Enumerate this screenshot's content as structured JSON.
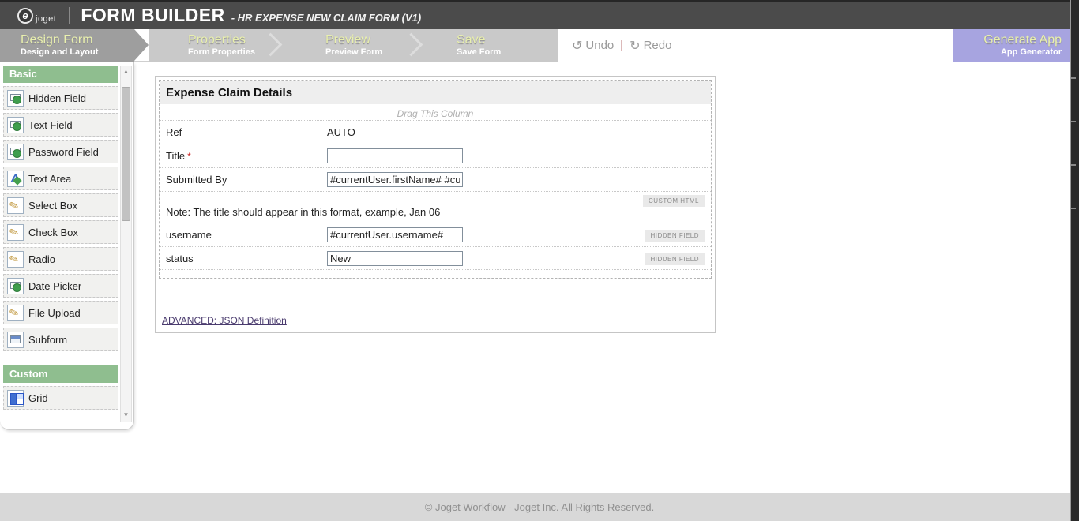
{
  "header": {
    "logo_glyph": "e",
    "logo_text": "joget",
    "app_title": "FORM BUILDER",
    "form_subtitle": "- HR EXPENSE NEW CLAIM FORM (V1)"
  },
  "tabs": [
    {
      "title": "Design Form",
      "subtitle": "Design and Layout",
      "active": true
    },
    {
      "title": "Properties",
      "subtitle": "Form Properties",
      "active": false
    },
    {
      "title": "Preview",
      "subtitle": "Preview Form",
      "active": false
    },
    {
      "title": "Save",
      "subtitle": "Save Form",
      "active": false
    }
  ],
  "toolbar": {
    "undo_icon": "↺",
    "undo_label": "Undo",
    "separator": "|",
    "redo_icon": "↻",
    "redo_label": "Redo"
  },
  "generate_tab": {
    "title": "Generate App",
    "subtitle": "App Generator"
  },
  "palette": {
    "sections": [
      {
        "title": "Basic",
        "items": [
          {
            "label": "Hidden Field",
            "icon": "textfield-icon"
          },
          {
            "label": "Text Field",
            "icon": "textfield-icon"
          },
          {
            "label": "Password Field",
            "icon": "textfield-icon"
          },
          {
            "label": "Text Area",
            "icon": "textarea-icon"
          },
          {
            "label": "Select Box",
            "icon": "pencil-box-icon"
          },
          {
            "label": "Check Box",
            "icon": "pencil-box-icon"
          },
          {
            "label": "Radio",
            "icon": "pencil-box-icon"
          },
          {
            "label": "Date Picker",
            "icon": "textfield-icon"
          },
          {
            "label": "File Upload",
            "icon": "pencil-box-icon"
          },
          {
            "label": "Subform",
            "icon": "subform-icon"
          }
        ]
      },
      {
        "title": "Custom",
        "items": [
          {
            "label": "Grid",
            "icon": "grid-icon"
          }
        ]
      }
    ],
    "scroll": {
      "up_glyph": "▲",
      "down_glyph": "▼"
    }
  },
  "form": {
    "title": "Expense Claim Details",
    "drag_hint": "Drag This Column",
    "rows": [
      {
        "label": "Ref",
        "value": "AUTO",
        "kind": "static"
      },
      {
        "label": "Title",
        "required_mark": "*",
        "value": "",
        "kind": "input"
      },
      {
        "label": "Submitted By",
        "value": "#currentUser.firstName# #cur",
        "kind": "input"
      },
      {
        "text": "Note: The title should appear in this format, example, Jan 06",
        "badge": "CUSTOM HTML",
        "kind": "html"
      },
      {
        "label": "username",
        "value": "#currentUser.username#",
        "badge": "HIDDEN FIELD",
        "kind": "input"
      },
      {
        "label": "status",
        "value": "New",
        "badge": "HIDDEN FIELD",
        "kind": "input"
      }
    ],
    "advanced_link": "ADVANCED: JSON Definition"
  },
  "footer": {
    "copyright": "© Joget Workflow - Joget Inc. All Rights Reserved."
  },
  "colors": {
    "topbar": "#4b4b4b",
    "active_tab": "#9e9e9e",
    "inactive_tab": "#c9c9c9",
    "tab_text_yellow": "#e9f0ae",
    "generate_purple": "#a7a4e0",
    "section_green": "#8fbe8f",
    "link_purple": "#4a3b6e"
  }
}
